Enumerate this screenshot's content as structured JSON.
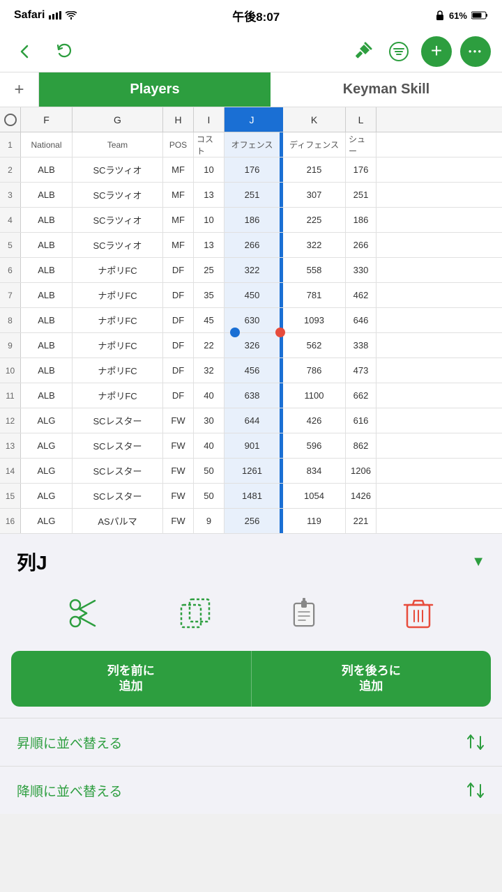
{
  "statusBar": {
    "appName": "Safari",
    "time": "午後8:07",
    "battery": "61%"
  },
  "tabs": [
    {
      "id": "players",
      "label": "Players",
      "active": true
    },
    {
      "id": "keyman",
      "label": "Keyman Skill",
      "active": false
    }
  ],
  "columns": [
    "F",
    "G",
    "H",
    "I",
    "J",
    "K",
    "L"
  ],
  "columnHeaders": {
    "row1": [
      "National",
      "Team",
      "POS",
      "コスト",
      "オフェンス",
      "ディフェンス",
      "シュー"
    ]
  },
  "rows": [
    {
      "num": 2,
      "f": "ALB",
      "g": "SCラツィオ",
      "h": "MF",
      "i": "10",
      "j": "176",
      "k": "215",
      "l": "176"
    },
    {
      "num": 3,
      "f": "ALB",
      "g": "SCラツィオ",
      "h": "MF",
      "i": "13",
      "j": "251",
      "k": "307",
      "l": "251"
    },
    {
      "num": 4,
      "f": "ALB",
      "g": "SCラツィオ",
      "h": "MF",
      "i": "10",
      "j": "186",
      "k": "225",
      "l": "186"
    },
    {
      "num": 5,
      "f": "ALB",
      "g": "SCラツィオ",
      "h": "MF",
      "i": "13",
      "j": "266",
      "k": "322",
      "l": "266"
    },
    {
      "num": 6,
      "f": "ALB",
      "g": "ナポリFC",
      "h": "DF",
      "i": "25",
      "j": "322",
      "k": "558",
      "l": "330"
    },
    {
      "num": 7,
      "f": "ALB",
      "g": "ナポリFC",
      "h": "DF",
      "i": "35",
      "j": "450",
      "k": "781",
      "l": "462"
    },
    {
      "num": 8,
      "f": "ALB",
      "g": "ナポリFC",
      "h": "DF",
      "i": "45",
      "j": "630",
      "k": "1093",
      "l": "646"
    },
    {
      "num": 9,
      "f": "ALB",
      "g": "ナポリFC",
      "h": "DF",
      "i": "22",
      "j": "326",
      "k": "562",
      "l": "338"
    },
    {
      "num": 10,
      "f": "ALB",
      "g": "ナポリFC",
      "h": "DF",
      "i": "32",
      "j": "456",
      "k": "786",
      "l": "473"
    },
    {
      "num": 11,
      "f": "ALB",
      "g": "ナポリFC",
      "h": "DF",
      "i": "40",
      "j": "638",
      "k": "1100",
      "l": "662"
    },
    {
      "num": 12,
      "f": "ALG",
      "g": "SCレスター",
      "h": "FW",
      "i": "30",
      "j": "644",
      "k": "426",
      "l": "616"
    },
    {
      "num": 13,
      "f": "ALG",
      "g": "SCレスター",
      "h": "FW",
      "i": "40",
      "j": "901",
      "k": "596",
      "l": "862"
    },
    {
      "num": 14,
      "f": "ALG",
      "g": "SCレスター",
      "h": "FW",
      "i": "50",
      "j": "1261",
      "k": "834",
      "l": "1206"
    },
    {
      "num": 15,
      "f": "ALG",
      "g": "SCレスター",
      "h": "FW",
      "i": "50",
      "j": "1481",
      "k": "1054",
      "l": "1426"
    },
    {
      "num": 16,
      "f": "ALG",
      "g": "ASパルマ",
      "h": "FW",
      "i": "9",
      "j": "256",
      "k": "119",
      "l": "221"
    }
  ],
  "panel": {
    "title": "列J",
    "actions": {
      "cut": "✂",
      "copy": "⧉",
      "paste": "⎘",
      "delete": "🗑"
    },
    "addBeforeLabel": "列を前に\n追加",
    "addAfterLabel": "列を後ろに\n追加",
    "sortAsc": "昇順に並べ替える",
    "sortDesc": "降順に並べ替える"
  }
}
